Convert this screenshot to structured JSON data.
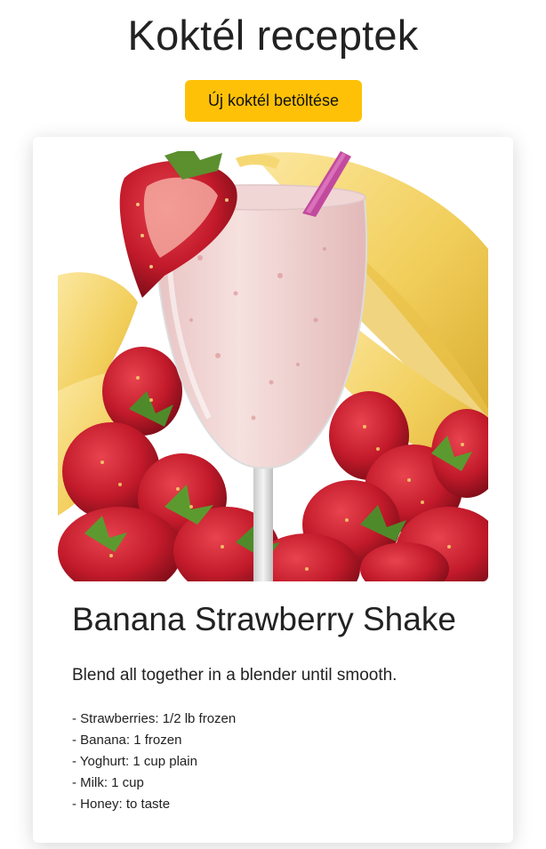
{
  "header": {
    "title": "Koktél receptek",
    "load_button_label": "Új koktél betöltése"
  },
  "cocktail": {
    "name": "Banana Strawberry Shake",
    "instructions": "Blend all together in a blender until smooth.",
    "ingredients": [
      "- Strawberries: 1/2 lb frozen",
      "- Banana: 1 frozen",
      "- Yoghurt: 1 cup plain",
      "- Milk: 1 cup",
      "- Honey: to taste"
    ]
  },
  "colors": {
    "button": "#ffc107",
    "card_background": "#ffffff",
    "text": "#212529"
  }
}
